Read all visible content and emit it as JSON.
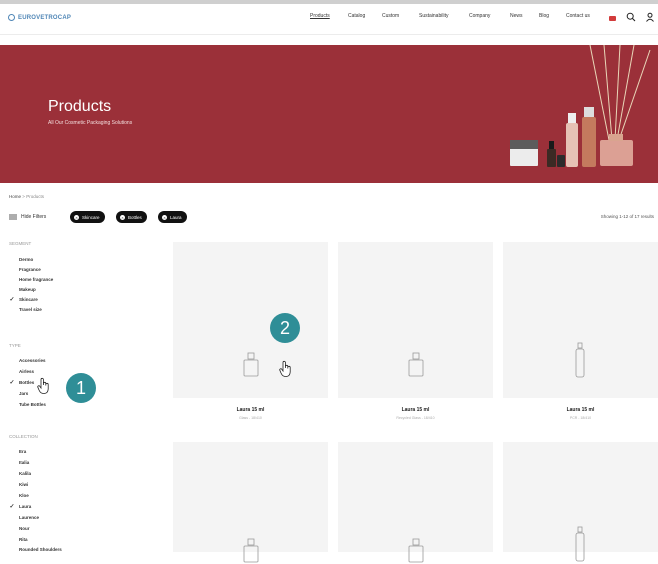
{
  "header": {
    "logo_text": "EUROVETROCAP",
    "nav": [
      "Products",
      "Catalog",
      "Custom",
      "Sustainability",
      "Company",
      "News",
      "Blog",
      "Contact us"
    ],
    "active_nav": "Products"
  },
  "hero": {
    "title": "Products",
    "subtitle": "All Our Cosmetic Packaging Solutions"
  },
  "breadcrumb": {
    "home": "Home",
    "separator": ">",
    "current": "Products"
  },
  "toolbar": {
    "hide_filters": "Hide Filters",
    "chips": [
      "Skincare",
      "Bottles",
      "Laura"
    ],
    "results": "Showing 1-12 of 17 results"
  },
  "filters": {
    "segment": {
      "heading": "SEGMENT",
      "options": [
        {
          "label": "Dermo",
          "checked": false
        },
        {
          "label": "Fragrance",
          "checked": false
        },
        {
          "label": "Home fragrance",
          "checked": false
        },
        {
          "label": "Makeup",
          "checked": false
        },
        {
          "label": "Skincare",
          "checked": true
        },
        {
          "label": "Travel size",
          "checked": false
        }
      ]
    },
    "type": {
      "heading": "TYPE",
      "options": [
        {
          "label": "Accessories",
          "checked": false
        },
        {
          "label": "Airless",
          "checked": false
        },
        {
          "label": "Bottles",
          "checked": true
        },
        {
          "label": "Jars",
          "checked": false
        },
        {
          "label": "Tube Bottles",
          "checked": false
        }
      ]
    },
    "collection": {
      "heading": "COLLECTION",
      "options": [
        {
          "label": "Era",
          "checked": false
        },
        {
          "label": "Italia",
          "checked": false
        },
        {
          "label": "Kalila",
          "checked": false
        },
        {
          "label": "Kiwi",
          "checked": false
        },
        {
          "label": "Kloe",
          "checked": false
        },
        {
          "label": "Laura",
          "checked": true
        },
        {
          "label": "Laurence",
          "checked": false
        },
        {
          "label": "Nour",
          "checked": false
        },
        {
          "label": "Rita",
          "checked": false
        },
        {
          "label": "Rounded Shoulders",
          "checked": false
        }
      ]
    }
  },
  "products": [
    {
      "title": "Laura 15 ml",
      "sub": "Glass - 18/410",
      "shape": "square-bottle"
    },
    {
      "title": "Laura 15 ml",
      "sub": "Recycled Glass - 18/410",
      "shape": "square-bottle"
    },
    {
      "title": "Laura 15 ml",
      "sub": "PCR - 18/410",
      "shape": "tall-bottle"
    },
    {
      "title": "",
      "sub": "",
      "shape": "square-bottle"
    },
    {
      "title": "",
      "sub": "",
      "shape": "square-bottle"
    },
    {
      "title": "",
      "sub": "",
      "shape": "tall-bottle"
    }
  ],
  "annotations": {
    "step1": "1",
    "step2": "2"
  },
  "colors": {
    "hero_bg": "#9b3039",
    "badge": "#2f8e97",
    "card_bg": "#f4f4f4",
    "chip_bg": "#111111"
  },
  "icons": [
    "search-icon",
    "user-icon",
    "filter-icon",
    "close-icon",
    "hand-cursor-icon",
    "flag-icon"
  ]
}
